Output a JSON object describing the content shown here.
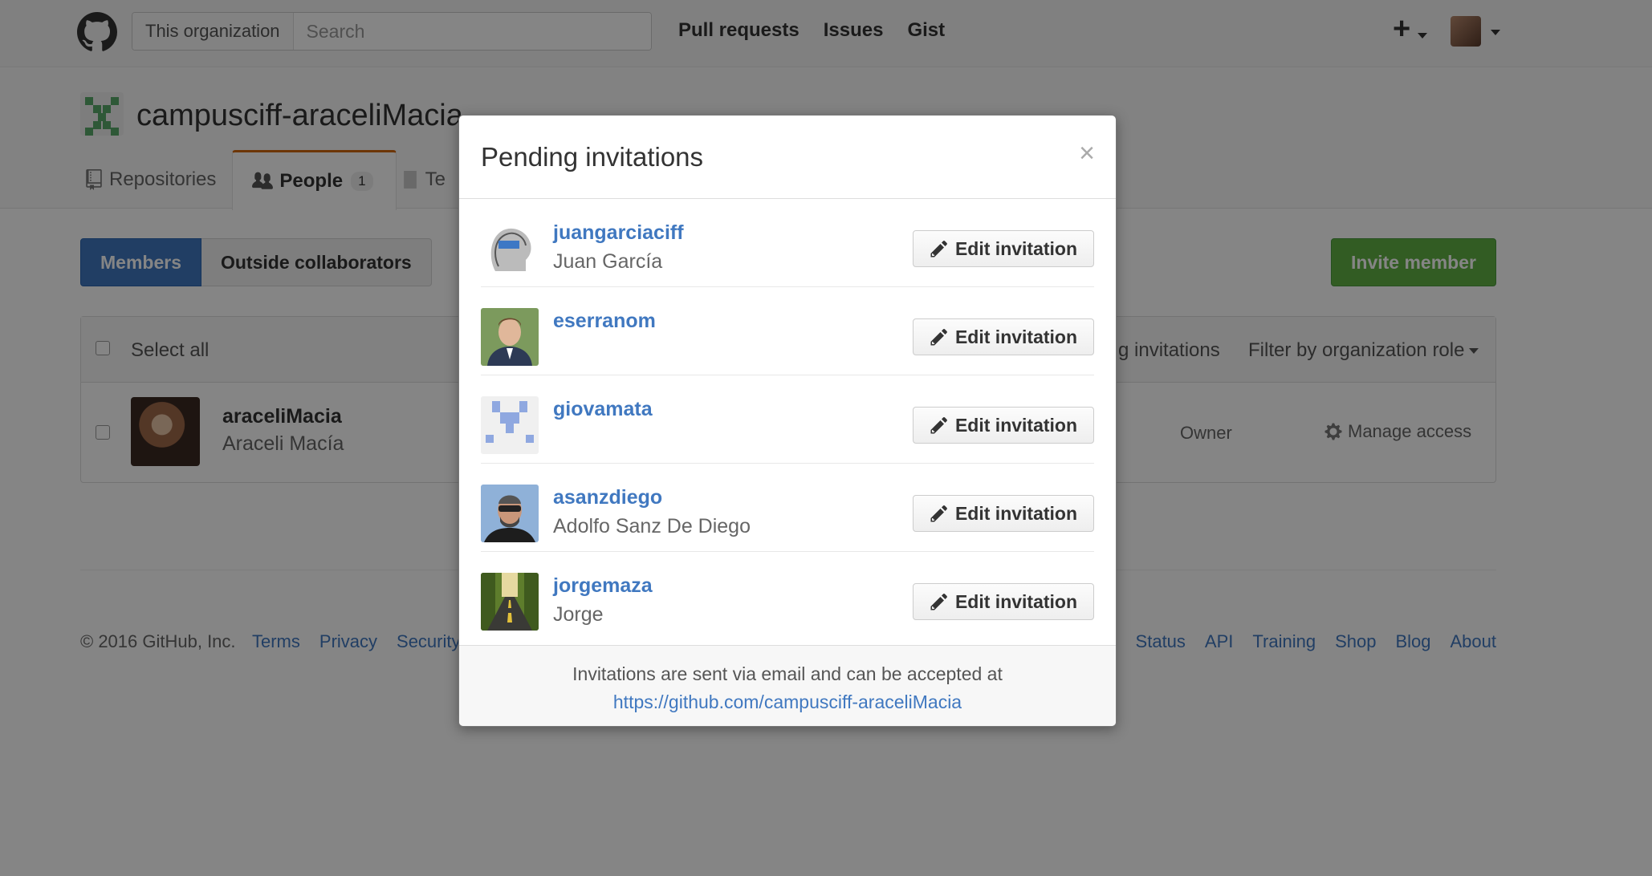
{
  "header": {
    "search_scope": "This organization",
    "search_placeholder": "Search",
    "nav": [
      "Pull requests",
      "Issues",
      "Gist"
    ],
    "new_symbol": "+"
  },
  "org": {
    "name": "campusciff-araceliMacia",
    "tabs": [
      {
        "label": "Repositories"
      },
      {
        "label": "People",
        "count": "1"
      },
      {
        "label": "Te"
      }
    ]
  },
  "people": {
    "segments": [
      "Members",
      "Outside collaborators"
    ],
    "invite_button": "Invite member",
    "select_all": "Select all",
    "pending_link": "g invitations",
    "filter_role": "Filter by organization role",
    "members": [
      {
        "login": "araceliMacia",
        "name": "Araceli Macía",
        "role": "Owner",
        "manage": "Manage access"
      }
    ]
  },
  "footer": {
    "copyright": "© 2016 GitHub, Inc.",
    "left_links": [
      "Terms",
      "Privacy",
      "Security"
    ],
    "right_links": [
      "Status",
      "API",
      "Training",
      "Shop",
      "Blog",
      "About"
    ]
  },
  "modal": {
    "title": "Pending invitations",
    "close": "×",
    "edit_label": "Edit invitation",
    "invitations": [
      {
        "login": "juangarciaciff",
        "name": "Juan García"
      },
      {
        "login": "eserranom",
        "name": ""
      },
      {
        "login": "giovamata",
        "name": ""
      },
      {
        "login": "asanzdiego",
        "name": "Adolfo Sanz De Diego"
      },
      {
        "login": "jorgemaza",
        "name": "Jorge"
      }
    ],
    "footer_note": "Invitations are sent via email and can be accepted at",
    "footer_link": "https://github.com/campusciff-araceliMacia"
  },
  "colors": {
    "link": "#4078c0",
    "primary": "#4078c0",
    "success": "#60b044",
    "tab_accent": "#d26911"
  }
}
